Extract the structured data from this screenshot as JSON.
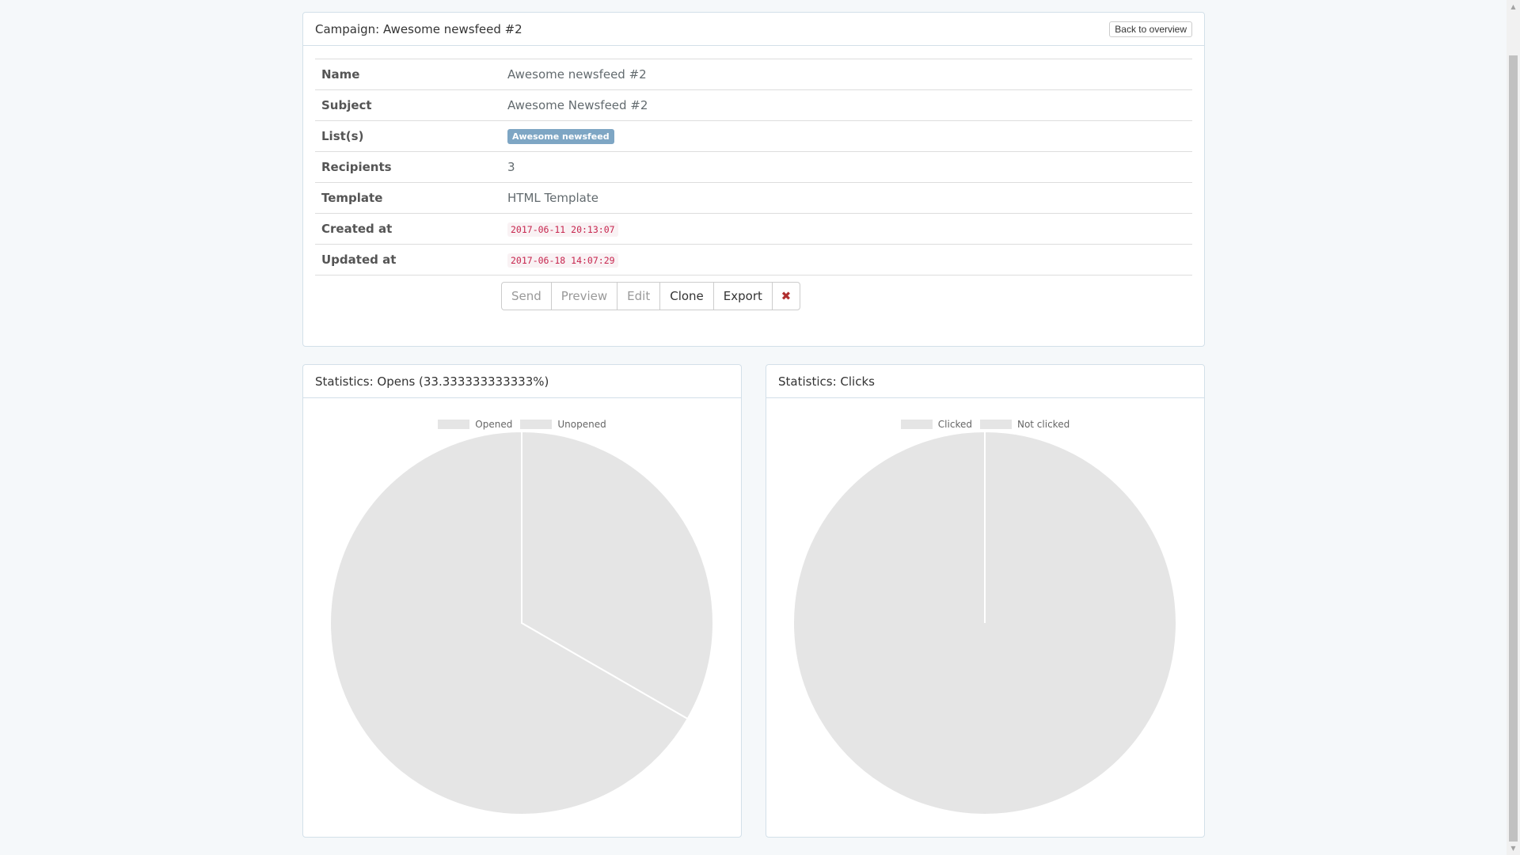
{
  "campaign": {
    "heading": "Campaign: Awesome newsfeed #2",
    "back_label": "Back to overview",
    "rows": [
      {
        "label": "Name",
        "value": "Awesome newsfeed #2"
      },
      {
        "label": "Subject",
        "value": "Awesome Newsfeed #2"
      },
      {
        "label": "List(s)",
        "badge": "Awesome newsfeed"
      },
      {
        "label": "Recipients",
        "value": "3"
      },
      {
        "label": "Template",
        "value": "HTML Template"
      },
      {
        "label": "Created at",
        "code": "2017-06-11 20:13:07"
      },
      {
        "label": "Updated at",
        "code": "2017-06-18 14:07:29"
      }
    ],
    "actions": {
      "send": "Send",
      "preview": "Preview",
      "edit": "Edit",
      "clone": "Clone",
      "export": "Export",
      "delete_icon": "✖"
    }
  },
  "opens": {
    "heading": "Statistics: Opens (33.333333333333%)"
  },
  "clicks": {
    "heading": "Statistics: Clicks"
  },
  "chart_data": [
    {
      "type": "pie",
      "categories": [
        "Opened",
        "Unopened"
      ],
      "values": [
        1,
        2
      ],
      "colors": [
        "#e5e5e5",
        "#e5e5e5"
      ],
      "legend": "top"
    },
    {
      "type": "pie",
      "categories": [
        "Clicked",
        "Not clicked"
      ],
      "values": [
        0,
        3
      ],
      "colors": [
        "#e5e5e5",
        "#e5e5e5"
      ],
      "legend": "top"
    }
  ],
  "colors": {
    "background": "#f5f8fa",
    "panel_border": "#d3e0e9",
    "badge": "#7ea6c4",
    "code_text": "#c7254e",
    "slice": "#e5e5e5"
  }
}
